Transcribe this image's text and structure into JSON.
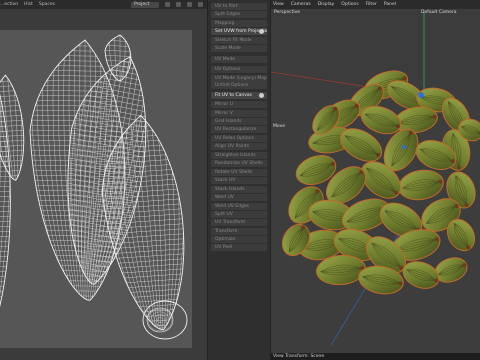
{
  "uv_editor": {
    "menu": [
      "...ection",
      "Hist",
      "Spaces"
    ],
    "project_selector": "Project"
  },
  "tools": [
    {
      "label": "UV to Part",
      "bright": false
    },
    {
      "label": "Split Edges",
      "bright": false
    },
    {
      "label": "Mapping",
      "bright": false
    },
    {
      "label": "Set UVW from Projection",
      "bright": true
    },
    {
      "label": "Stretch Fit Mode",
      "bright": false
    },
    {
      "label": "Scale Mode",
      "bright": false
    },
    {
      "label": "UV Mode",
      "bright": false
    },
    {
      "label": "UV Options",
      "bright": false
    },
    {
      "label": "UV Mode (Legacy) Mapping",
      "bright": false
    },
    {
      "label": "Unfold Options",
      "bright": false
    },
    {
      "label": "Fit UV to Canvas",
      "bright": true
    },
    {
      "label": "Mirror U",
      "bright": false
    },
    {
      "label": "Mirror V",
      "bright": false
    },
    {
      "label": "Grid Islands",
      "bright": false
    },
    {
      "label": "UV Rectangularize",
      "bright": false
    },
    {
      "label": "UV Relax Options",
      "bright": false
    },
    {
      "label": "Align UV Points",
      "bright": false
    },
    {
      "label": "Straighten Islands",
      "bright": false
    },
    {
      "label": "Randomize UV Shells",
      "bright": false
    },
    {
      "label": "Rotate UV Shells",
      "bright": false
    },
    {
      "label": "Stack UV",
      "bright": false
    },
    {
      "label": "Stack Islands",
      "bright": false
    },
    {
      "label": "Weld UV",
      "bright": false
    },
    {
      "label": "Weld UV Edges",
      "bright": false
    },
    {
      "label": "Split UV",
      "bright": false
    },
    {
      "label": "UV Transform",
      "bright": false
    },
    {
      "label": "Transform",
      "bright": false
    },
    {
      "label": "Optimize",
      "bright": false
    },
    {
      "label": "UV Peel",
      "bright": false
    }
  ],
  "viewport": {
    "menu": [
      "View",
      "Cameras",
      "Display",
      "Options",
      "Filter",
      "Panel"
    ],
    "view_label": "Perspective",
    "camera_label": "Default Camera",
    "mode_label": "Move",
    "status": "View Transform: Scene"
  }
}
